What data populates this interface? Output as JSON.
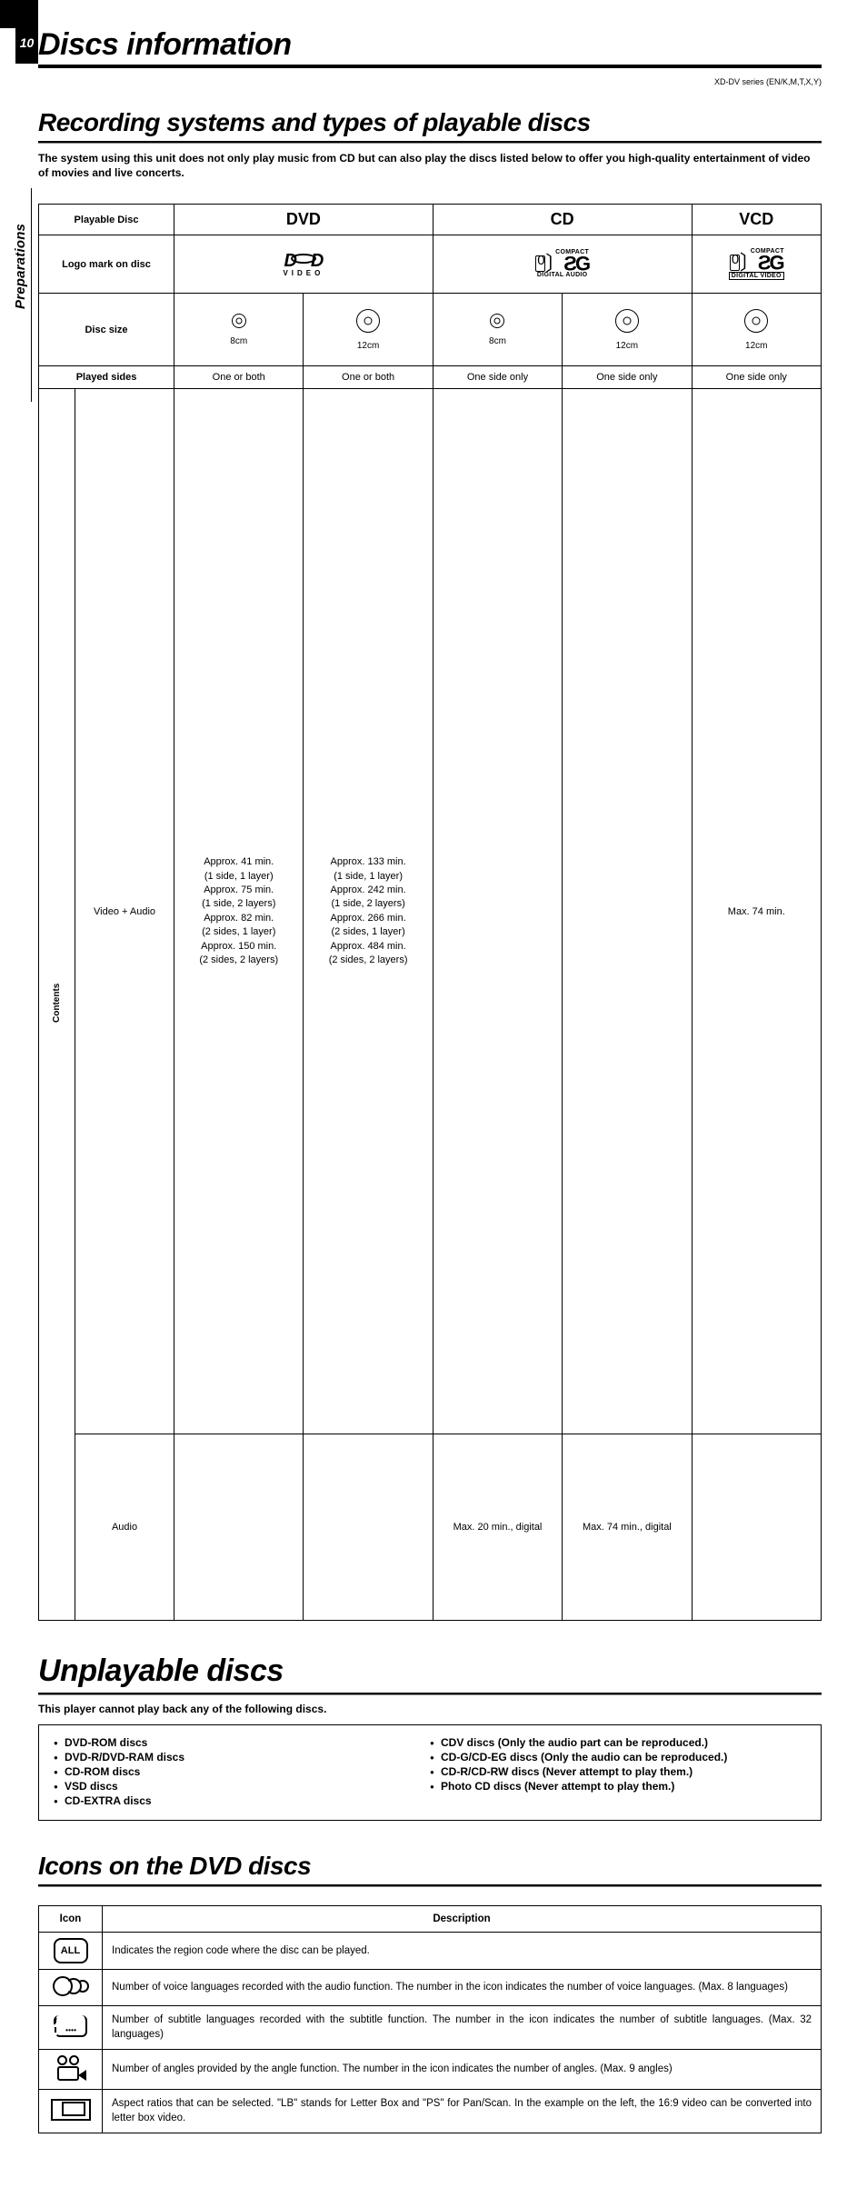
{
  "page_number": "10",
  "main_title": "Discs information",
  "model_code": "XD-DV series (EN/K,M,T,X,Y)",
  "side_tab": "Preparations",
  "section1": {
    "title": "Recording systems and types of playable discs",
    "intro": "The system using this unit does not only play music from CD but can also play the discs listed below to offer you high-quality entertainment of video of movies and live concerts."
  },
  "playable_table": {
    "row_headers": {
      "playable_disc": "Playable Disc",
      "logo": "Logo mark on disc",
      "disc_size": "Disc size",
      "played_sides": "Played sides",
      "contents": "Contents",
      "video_audio": "Video + Audio",
      "audio": "Audio"
    },
    "formats": {
      "dvd": "DVD",
      "cd": "CD",
      "vcd": "VCD"
    },
    "dvd_logo_sub": "VIDEO",
    "cd_logo": {
      "compact": "COMPACT",
      "sub": "DIGITAL AUDIO"
    },
    "vcd_logo": {
      "compact": "COMPACT",
      "sub": "DIGITAL VIDEO"
    },
    "sizes": {
      "s8": "8cm",
      "s12": "12cm"
    },
    "played": {
      "one_or_both": "One or both",
      "one_side": "One side only"
    },
    "dvd8": {
      "l1": "Approx. 41 min.",
      "l2": "(1 side, 1 layer)",
      "l3": "Approx. 75 min.",
      "l4": "(1 side, 2 layers)",
      "l5": "Approx. 82 min.",
      "l6": "(2 sides, 1 layer)",
      "l7": "Approx. 150 min.",
      "l8": "(2 sides, 2 layers)"
    },
    "dvd12": {
      "l1": "Approx. 133 min.",
      "l2": "(1 side, 1 layer)",
      "l3": "Approx. 242 min.",
      "l4": "(1 side, 2 layers)",
      "l5": "Approx. 266 min.",
      "l6": "(2 sides, 1 layer)",
      "l7": "Approx. 484 min.",
      "l8": "(2 sides, 2 layers)"
    },
    "vcd_va": "Max. 74 min.",
    "cd8_audio": "Max. 20 min., digital",
    "cd12_audio": "Max. 74 min., digital"
  },
  "section2": {
    "title": "Unplayable discs",
    "intro": "This player cannot play back any of the following discs.",
    "left": [
      "DVD-ROM discs",
      "DVD-R/DVD-RAM discs",
      "CD-ROM discs",
      "VSD discs",
      "CD-EXTRA discs"
    ],
    "right": [
      "CDV discs (Only the audio part can be reproduced.)",
      "CD-G/CD-EG discs (Only the audio can be reproduced.)",
      "CD-R/CD-RW discs (Never attempt to play them.)",
      "Photo CD discs (Never attempt to play them.)"
    ]
  },
  "section3": {
    "title": "Icons on the DVD discs",
    "headers": {
      "icon": "Icon",
      "desc": "Description"
    },
    "rows": [
      {
        "icon_label": "ALL",
        "desc": "Indicates the region code where the disc can be played."
      },
      {
        "desc": "Number of voice languages recorded with the audio function. The number in the icon indicates the number of voice languages. (Max. 8 languages)"
      },
      {
        "desc": "Number of subtitle languages recorded with the subtitle function. The number in the icon indicates the number of subtitle languages. (Max. 32 languages)"
      },
      {
        "desc": "Number of angles provided by the angle function. The number in the icon indicates the number of angles. (Max. 9 angles)"
      },
      {
        "desc": "Aspect ratios that can be selected. \"LB\" stands for Letter Box and \"PS\" for Pan/Scan. In the example on the left, the 16:9 video can be converted into letter box video."
      }
    ]
  }
}
